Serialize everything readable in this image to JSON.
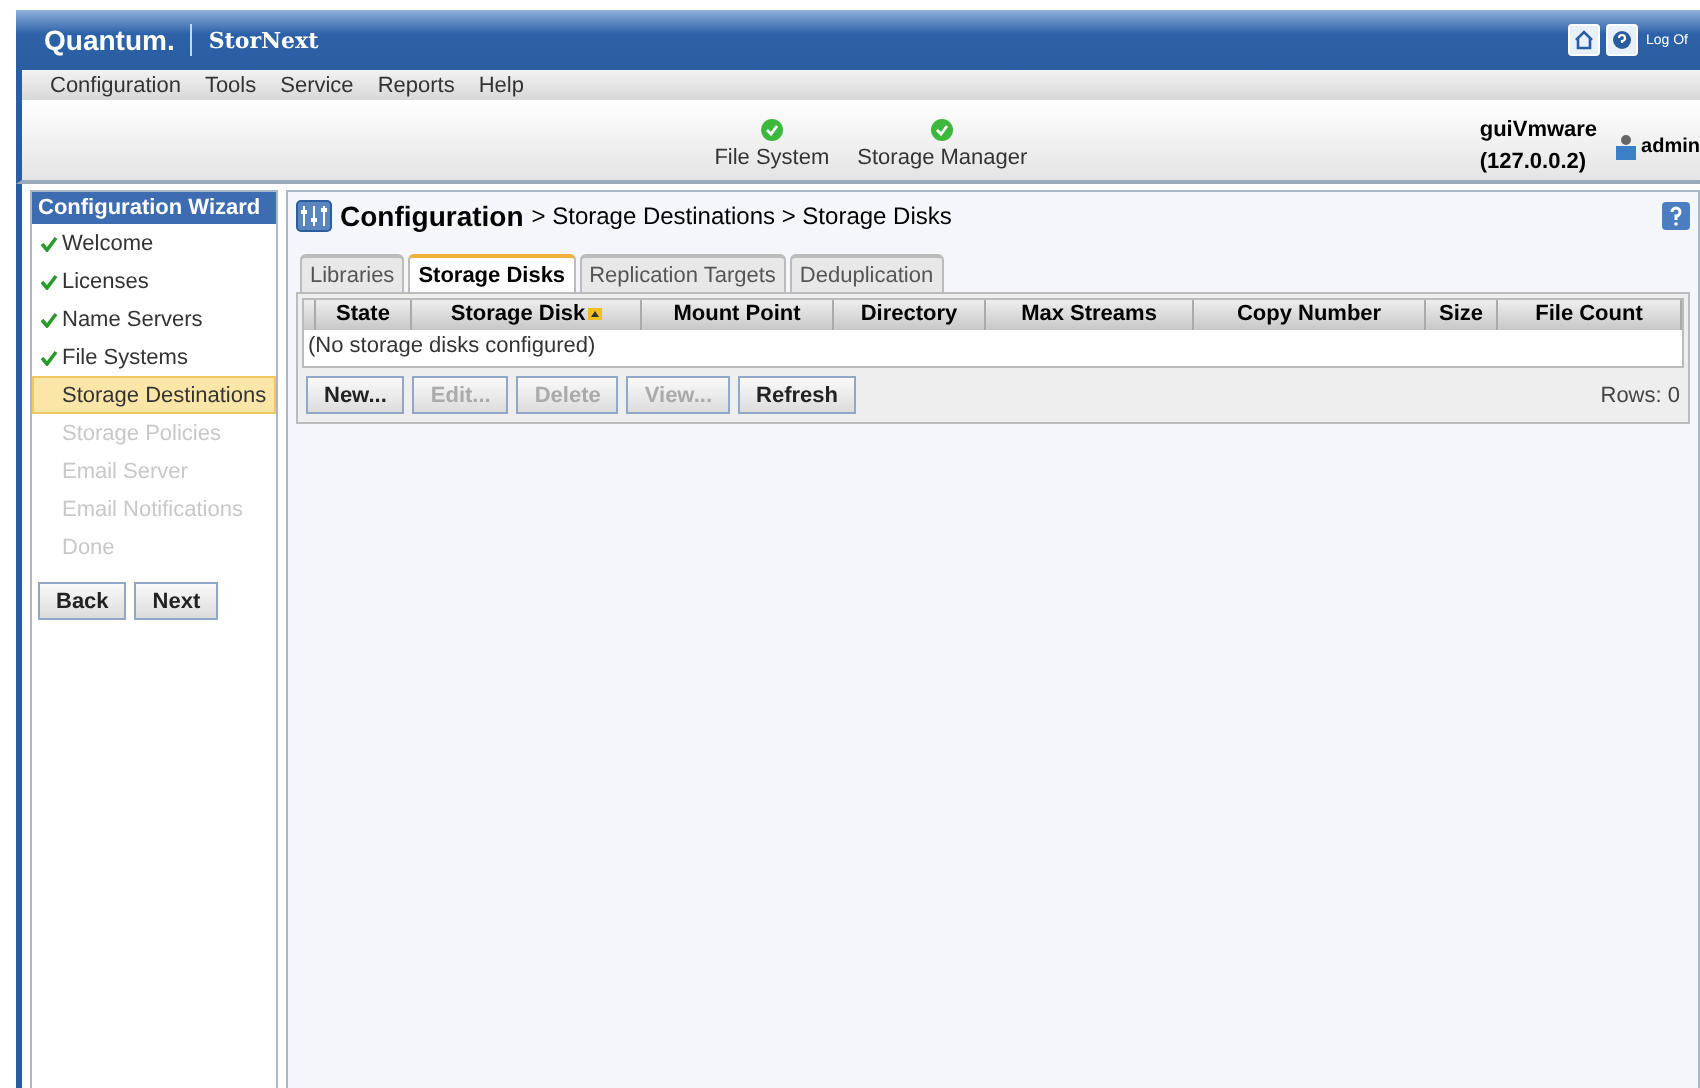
{
  "header": {
    "brand": "Quantum.",
    "product": "StorNext",
    "logout": "Log Of"
  },
  "menu": [
    "Configuration",
    "Tools",
    "Service",
    "Reports",
    "Help"
  ],
  "status_items": [
    {
      "label": "File System",
      "ok": true
    },
    {
      "label": "Storage Manager",
      "ok": true
    }
  ],
  "host": {
    "name": "guiVmware",
    "address": "(127.0.0.2)",
    "user": "admin"
  },
  "wizard": {
    "title": "Configuration Wizard",
    "steps": [
      {
        "label": "Welcome",
        "done": true,
        "selected": false,
        "disabled": false
      },
      {
        "label": "Licenses",
        "done": true,
        "selected": false,
        "disabled": false
      },
      {
        "label": "Name Servers",
        "done": true,
        "selected": false,
        "disabled": false
      },
      {
        "label": "File Systems",
        "done": true,
        "selected": false,
        "disabled": false
      },
      {
        "label": "Storage Destinations",
        "done": false,
        "selected": true,
        "disabled": false
      },
      {
        "label": "Storage Policies",
        "done": false,
        "selected": false,
        "disabled": true
      },
      {
        "label": "Email Server",
        "done": false,
        "selected": false,
        "disabled": true
      },
      {
        "label": "Email Notifications",
        "done": false,
        "selected": false,
        "disabled": true
      },
      {
        "label": "Done",
        "done": false,
        "selected": false,
        "disabled": true
      }
    ],
    "buttons": [
      "Back",
      "Next"
    ]
  },
  "breadcrumb": {
    "title": "Configuration",
    "path": "> Storage Destinations > Storage Disks"
  },
  "tabs": [
    {
      "label": "Libraries",
      "selected": false
    },
    {
      "label": "Storage Disks",
      "selected": true
    },
    {
      "label": "Replication Targets",
      "selected": false
    },
    {
      "label": "Deduplication",
      "selected": false
    }
  ],
  "table": {
    "columns": [
      {
        "label": "State",
        "sorted": false
      },
      {
        "label": "Storage Disk",
        "sorted": true
      },
      {
        "label": "Mount Point",
        "sorted": false
      },
      {
        "label": "Directory",
        "sorted": false
      },
      {
        "label": "Max Streams",
        "sorted": false
      },
      {
        "label": "Copy Number",
        "sorted": false
      },
      {
        "label": "Size",
        "sorted": false
      },
      {
        "label": "File Count",
        "sorted": false
      }
    ],
    "empty_message": "(No storage disks configured)"
  },
  "actions": [
    {
      "label": "New...",
      "disabled": false
    },
    {
      "label": "Edit...",
      "disabled": true
    },
    {
      "label": "Delete",
      "disabled": true
    },
    {
      "label": "View...",
      "disabled": true
    },
    {
      "label": "Refresh",
      "disabled": false
    }
  ],
  "rows_count": "Rows: 0"
}
